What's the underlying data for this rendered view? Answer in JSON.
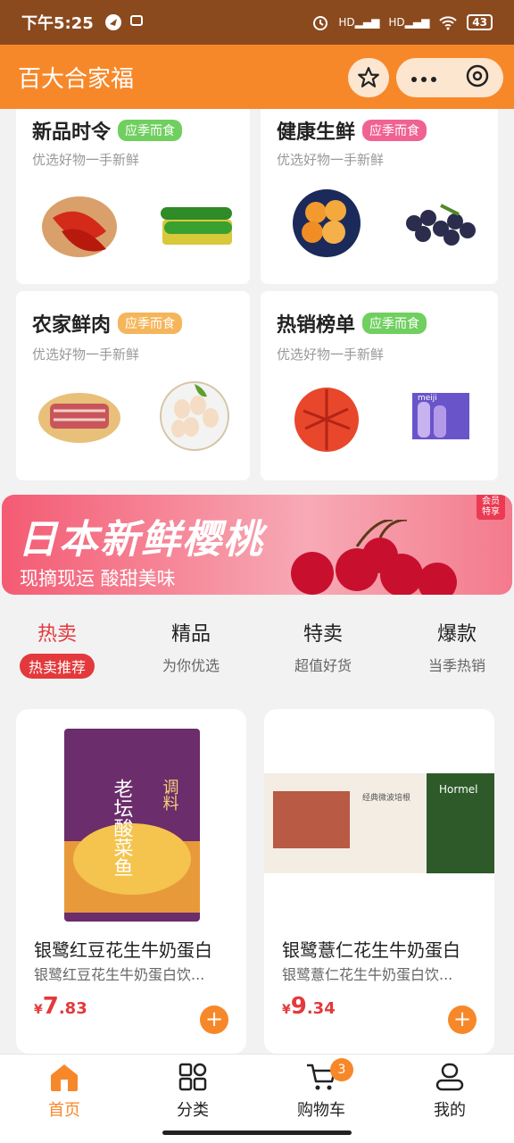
{
  "status_bar": {
    "time": "下午5:25",
    "signal_1": "HD",
    "signal_2": "HD",
    "battery": "43"
  },
  "header": {
    "title": "百大合家福"
  },
  "categories": [
    {
      "title": "新品时令",
      "badge": "应季而食",
      "badge_color": "#6fcf5f",
      "subtitle": "优选好物一手新鲜"
    },
    {
      "title": "健康生鲜",
      "badge": "应季而食",
      "badge_color": "#f06292",
      "subtitle": "优选好物一手新鲜"
    },
    {
      "title": "农家鲜肉",
      "badge": "应季而食",
      "badge_color": "#f5b55a",
      "subtitle": "优选好物一手新鲜"
    },
    {
      "title": "热销榜单",
      "badge": "应季而食",
      "badge_color": "#6fcf5f",
      "subtitle": "优选好物一手新鲜"
    }
  ],
  "banner": {
    "title": "日本新鲜樱桃",
    "subtitle": "现摘现运 酸甜美味",
    "tag_line1": "会员",
    "tag_line2": "特享"
  },
  "tabs": [
    {
      "main": "热卖",
      "sub": "热卖推荐",
      "active": true
    },
    {
      "main": "精品",
      "sub": "为你优选"
    },
    {
      "main": "特卖",
      "sub": "超值好货"
    },
    {
      "main": "爆款",
      "sub": "当季热销"
    }
  ],
  "products": [
    {
      "name": "银鹭红豆花生牛奶蛋白",
      "desc": "银鹭红豆花生牛奶蛋白饮...",
      "currency": "¥",
      "price_int": "7",
      "price_dec": ".83",
      "pack_text_1": "老坛酸菜鱼",
      "pack_text_2": "调料"
    },
    {
      "name": "银鹭薏仁花生牛奶蛋白",
      "desc": "银鹭薏仁花生牛奶蛋白饮...",
      "currency": "¥",
      "price_int": "9",
      "price_dec": ".34",
      "pack_text_1": "Hormel",
      "pack_text_2": "经典微波培根"
    }
  ],
  "bottom_nav": [
    {
      "label": "首页",
      "active": true
    },
    {
      "label": "分类"
    },
    {
      "label": "购物车",
      "badge": "3"
    },
    {
      "label": "我的"
    }
  ],
  "colors": {
    "accent": "#f7882a",
    "red": "#e4393c",
    "status_bar": "#8a4a1e"
  }
}
